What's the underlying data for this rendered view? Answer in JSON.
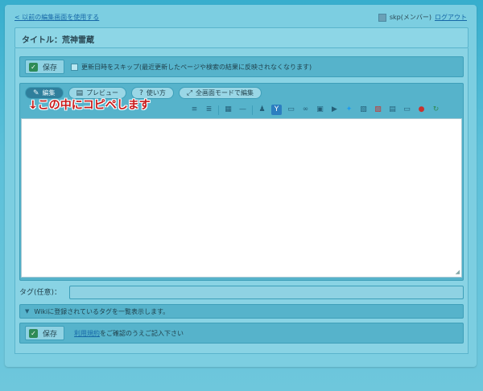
{
  "header": {
    "back_link": "< 以前の編集画面を使用する",
    "user_label": "skp(メンバー)",
    "logout": "ログアウト"
  },
  "title": "タイトル：荒神雷蔵",
  "save_bar": {
    "save_label": "保存",
    "skip_label": "更新日時をスキップ(最近更新したページや検索の結果に反映されなくなります)"
  },
  "editor": {
    "tabs": [
      {
        "label": "編集",
        "icon": "edit-icon"
      },
      {
        "label": "プレビュー",
        "icon": "preview-icon"
      },
      {
        "label": "使い方",
        "icon": "help-icon"
      },
      {
        "label": "全画面モードで編集",
        "icon": "fullscreen-icon"
      }
    ],
    "annotation": "↓この中にコピペします",
    "toolbar_icons": [
      "align-left-icon",
      "align-right-icon",
      "table-icon",
      "hr-icon",
      "stamp-icon",
      "amazon-icon",
      "comment-icon",
      "link-icon",
      "image-icon",
      "movie-icon",
      "twitter-icon",
      "embed-icon",
      "mixi-icon",
      "calendar-icon",
      "photo-icon",
      "pin-icon",
      "refresh-icon"
    ]
  },
  "tags": {
    "label": "タグ(任意)：",
    "wiki_hint": "Wikiに登録されているタグを一覧表示します。"
  },
  "bottom": {
    "save_label": "保存",
    "terms_link": "利用規約",
    "terms_text": "をご確認のうえご記入下さい"
  },
  "colors": {
    "background": "#37aecd",
    "panel": "#7ccee1",
    "annotation": "#c81919"
  }
}
